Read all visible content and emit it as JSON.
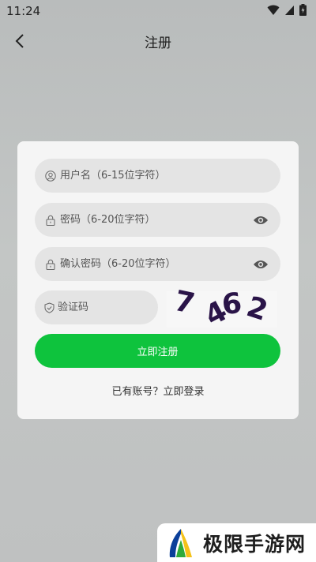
{
  "status_bar": {
    "time": "11:24"
  },
  "header": {
    "title": "注册"
  },
  "form": {
    "username_placeholder": "用户名（6-15位字符）",
    "password_placeholder": "密码（6-20位字符）",
    "confirm_password_placeholder": "确认密码（6-20位字符）",
    "captcha_placeholder": "验证码",
    "captcha_code": [
      "7",
      "4",
      "6",
      "2"
    ]
  },
  "actions": {
    "register_label": "立即注册",
    "login_link": "已有账号？立即登录"
  },
  "watermark": {
    "text": "极限手游网"
  },
  "colors": {
    "primary": "#0ec33d",
    "card": "#f5f5f5",
    "field": "#e4e4e4"
  }
}
